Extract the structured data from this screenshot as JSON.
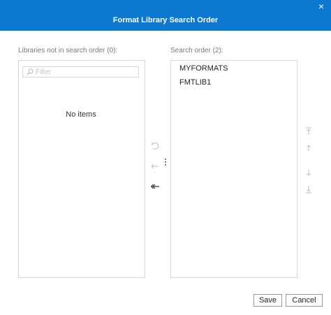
{
  "dialog": {
    "title": "Format Library Search Order",
    "close_glyph": "×"
  },
  "left_panel": {
    "label": "Libraries not in search order (0):",
    "filter_placeholder": "Filter",
    "empty_text": "No items"
  },
  "right_panel": {
    "label": "Search order (2):",
    "items": [
      "MYFORMATS",
      "FMTLIB1"
    ]
  },
  "icons": {
    "filter": "search-icon",
    "undo": "undo-icon",
    "move_left": "move-left-icon",
    "move_all_left": "move-all-left-icon",
    "more": "more-vertical-icon",
    "move_top": "move-to-top-icon",
    "move_up": "move-up-icon",
    "move_down": "move-down-icon",
    "move_bottom": "move-to-bottom-icon"
  },
  "footer": {
    "save_label": "Save",
    "cancel_label": "Cancel"
  },
  "colors": {
    "title_bar": "#0d78cf",
    "border": "#d6d6d6",
    "disabled_icon": "#c8c8c8",
    "enabled_icon": "#333333"
  }
}
